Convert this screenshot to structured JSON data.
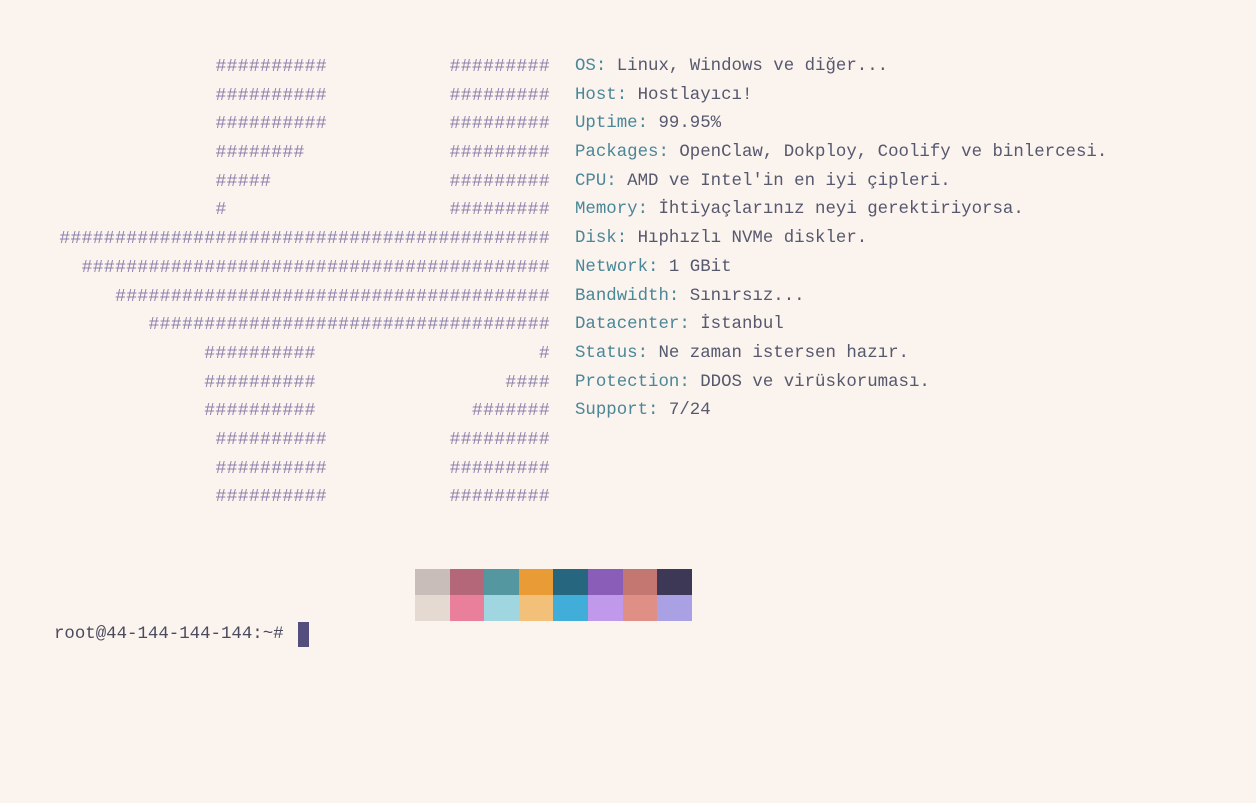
{
  "ascii_art": [
    "##########           #########",
    "##########           #########",
    "##########           #########",
    "########             #########",
    "#####                #########",
    "#                    #########",
    "############################################",
    "##########################################",
    "#######################################",
    "####################################",
    "##########                    #",
    "##########                 ####",
    "##########              #######",
    "##########           #########",
    "##########           #########",
    "##########           #########"
  ],
  "sysinfo": [
    {
      "key": "OS:",
      "value": " Linux, Windows ve diğer..."
    },
    {
      "key": "Host:",
      "value": " Hostlayıcı!"
    },
    {
      "key": "Uptime:",
      "value": " 99.95%"
    },
    {
      "key": "Packages:",
      "value": " OpenClaw, Dokploy, Coolify ve binlercesi."
    },
    {
      "key": "CPU:",
      "value": " AMD ve Intel'in en iyi çipleri."
    },
    {
      "key": "Memory:",
      "value": " İhtiyaçlarınız neyi gerektiriyorsa."
    },
    {
      "key": "Disk:",
      "value": " Hıphızlı NVMe diskler."
    },
    {
      "key": "Network:",
      "value": " 1 GBit"
    },
    {
      "key": "Bandwidth:",
      "value": " Sınırsız..."
    },
    {
      "key": "Datacenter:",
      "value": " İstanbul"
    },
    {
      "key": "Status:",
      "value": " Ne zaman istersen hazır."
    },
    {
      "key": "Protection:",
      "value": " DDOS ve virüskoruması."
    },
    {
      "key": "Support:",
      "value": " 7/24"
    }
  ],
  "palette": {
    "normal": [
      "#c8bdb8",
      "#b46779",
      "#5597a0",
      "#e99b35",
      "#26677f",
      "#8a5eb8",
      "#c47771",
      "#3c3856"
    ],
    "bright": [
      "#e5dad2",
      "#e97f9b",
      "#a0d6e0",
      "#f3c07a",
      "#41aed9",
      "#c199ea",
      "#df8f86",
      "#a9a1e3"
    ]
  },
  "prompt": {
    "text": "root@44-144-144-144:~#"
  }
}
